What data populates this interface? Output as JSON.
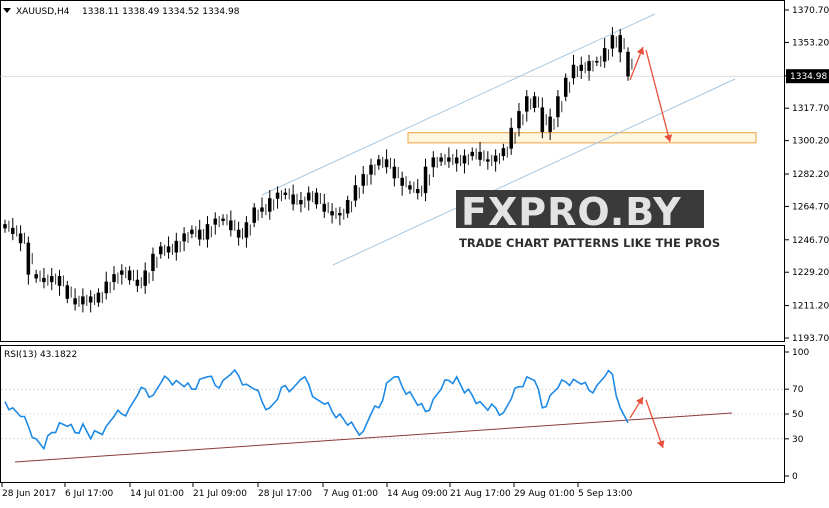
{
  "chart_data": [
    {
      "type": "candlestick",
      "symbol_label": "XAUUSD,H4",
      "ohlc_label": "1338.11 1338.49 1334.52 1334.98",
      "current_price_label": "1334.98",
      "ylim": [
        1190.0,
        1373.5
      ],
      "y_ticks": [
        "1370.70",
        "1353.20",
        "1335.20",
        "1317.70",
        "1300.20",
        "1282.20",
        "1264.70",
        "1246.70",
        "1229.20",
        "1211.20",
        "1193.70"
      ],
      "x_ticks": [
        "28 Jun 2017",
        "6 Jul 17:00",
        "14 Jul 01:00",
        "21 Jul 09:00",
        "28 Jul 17:00",
        "7 Aug 01:00",
        "14 Aug 09:00",
        "21 Aug 17:00",
        "29 Aug 01:00",
        "5 Sep 13:00"
      ],
      "close_series": [
        1253,
        1250,
        1245,
        1228,
        1226,
        1224,
        1227,
        1222,
        1215,
        1212,
        1216,
        1213,
        1218,
        1224,
        1228,
        1230,
        1225,
        1222,
        1230,
        1239,
        1243,
        1240,
        1246,
        1250,
        1252,
        1247,
        1255,
        1258,
        1257,
        1252,
        1248,
        1256,
        1264,
        1262,
        1269,
        1272,
        1271,
        1266,
        1268,
        1272,
        1266,
        1262,
        1260,
        1261,
        1268,
        1276,
        1282,
        1287,
        1290,
        1286,
        1280,
        1276,
        1274,
        1272,
        1286,
        1291,
        1289,
        1291,
        1288,
        1292,
        1294,
        1290,
        1289,
        1292,
        1296,
        1307,
        1316,
        1324,
        1318,
        1305,
        1313,
        1324,
        1334,
        1341,
        1338,
        1343,
        1343,
        1350,
        1357,
        1348,
        1335
      ],
      "channel": "rising parallel channel",
      "support_zone": [
        1299.0,
        1304.5
      ]
    },
    {
      "type": "line",
      "label": "RSI(13) 43.1822",
      "ylim": [
        0,
        100
      ],
      "y_ticks": [
        "100",
        "70",
        "50",
        "30",
        "0"
      ],
      "values": [
        60,
        55,
        48,
        40,
        30,
        22,
        35,
        43,
        40,
        35,
        42,
        30,
        35,
        40,
        48,
        50,
        55,
        65,
        70,
        65,
        75,
        78,
        77,
        72,
        70,
        78,
        80,
        73,
        77,
        82,
        81,
        74,
        70,
        60,
        55,
        62,
        73,
        71,
        78,
        74,
        62,
        58,
        52,
        50,
        41,
        38,
        36,
        50,
        55,
        75,
        80,
        72,
        68,
        57,
        52,
        62,
        70,
        77,
        80,
        67,
        65,
        60,
        53,
        55,
        51,
        62,
        72,
        80,
        77,
        55,
        65,
        71,
        76,
        78,
        74,
        69,
        73,
        80,
        82,
        55,
        43
      ]
    }
  ]
}
